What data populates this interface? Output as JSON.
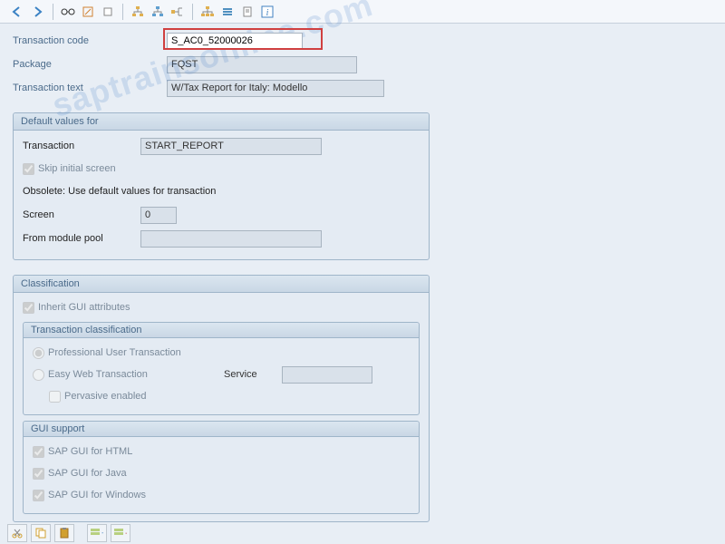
{
  "header": {
    "transaction_code_label": "Transaction code",
    "transaction_code_value": "S_AC0_52000026",
    "package_label": "Package",
    "package_value": "FQST",
    "transaction_text_label": "Transaction text",
    "transaction_text_value": "W/Tax Report for Italy: Modello"
  },
  "default_values": {
    "title": "Default values for",
    "transaction_label": "Transaction",
    "transaction_value": "START_REPORT",
    "skip_initial_label": "Skip initial screen",
    "obsolete_text": "Obsolete: Use default values for transaction",
    "screen_label": "Screen",
    "screen_value": "0",
    "from_module_pool_label": "From module pool",
    "from_module_pool_value": ""
  },
  "classification": {
    "title": "Classification",
    "inherit_label": "Inherit GUI attributes",
    "trans_class_title": "Transaction classification",
    "prof_user_label": "Professional User Transaction",
    "easy_web_label": "Easy Web Transaction",
    "service_label": "Service",
    "pervasive_label": "Pervasive enabled",
    "gui_support_title": "GUI support",
    "gui_html_label": "SAP GUI for HTML",
    "gui_java_label": "SAP GUI for Java",
    "gui_win_label": "SAP GUI for Windows"
  },
  "watermark": "saptrainsonline.com"
}
